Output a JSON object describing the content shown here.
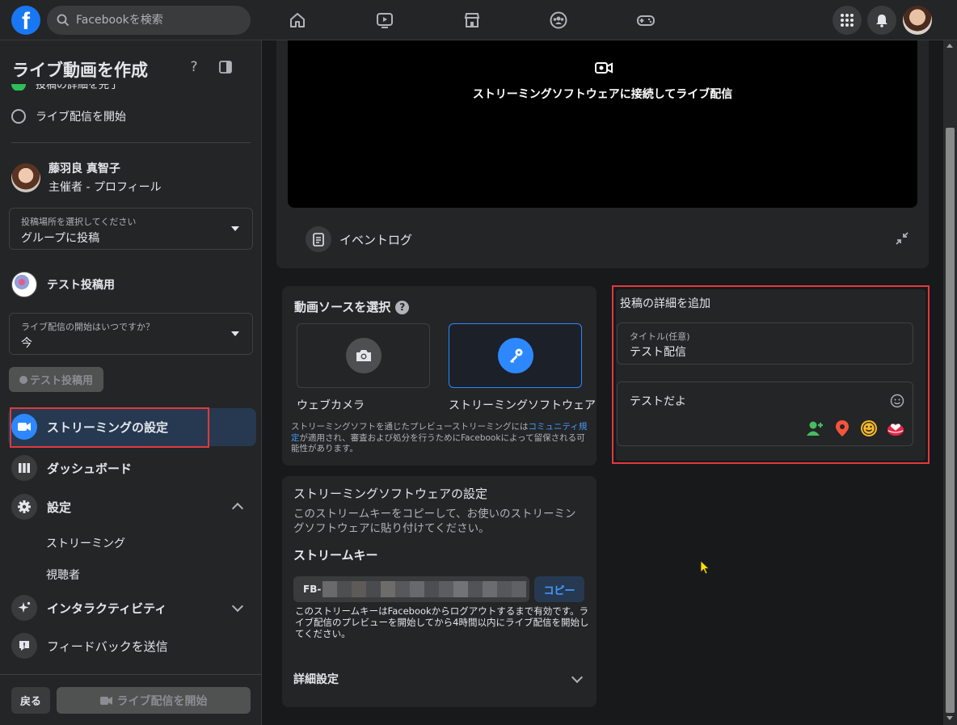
{
  "topbar": {
    "logo_letter": "f",
    "search_placeholder": "Facebookを検索"
  },
  "sidebar": {
    "title": "ライブ動画を作成",
    "step_cut": "投稿の詳細を完了",
    "step_next": "ライブ配信を開始",
    "host": {
      "name": "藤羽良 真智子",
      "role": "主催者 - プロフィール"
    },
    "post_location": {
      "label": "投稿場所を選択してください",
      "value": "グループに投稿"
    },
    "group_name": "テスト投稿用",
    "start_time": {
      "label": "ライブ配信の開始はいつですか？",
      "value": "今"
    },
    "group_button": "テスト投稿用",
    "menu": {
      "streaming_setup": "ストリーミングの設定",
      "dashboard": "ダッシュボード",
      "settings": "設定",
      "settings_sub": [
        "ストリーミング",
        "視聴者"
      ],
      "interactivity": "インタラクティビティ",
      "feedback": "フィードバックを送信"
    },
    "back_button": "戻る",
    "start_button": "ライブ配信を開始"
  },
  "preview": {
    "message": "ストリーミングソフトウェアに接続してライブ配信",
    "event_log": "イベントログ"
  },
  "video_source": {
    "title": "動画ソースを選択",
    "options": [
      "ウェブカメラ",
      "ストリーミングソフトウェア"
    ],
    "selected": "ストリーミングソフトウェア",
    "note_before": "ストリーミングソフトを通じたプレビューストリーミングには",
    "note_link": "コミュニティ規定",
    "note_after": "が適用され、審査および処分を行うためにFacebookによって留保される可能性があります。"
  },
  "software_settings": {
    "title": "ストリーミングソフトウェアの設定",
    "desc": "このストリームキーをコピーして、お使いのストリーミングソフトウェアに貼り付けてください。",
    "key_heading": "ストリームキー",
    "key_prefix": "FB-",
    "copy_button": "コピー",
    "key_note": "このストリームキーはFacebookからログアウトするまで有効です。ライブ配信のプレビューを開始してから4時間以内にライブ配信を開始してください。",
    "advanced": "詳細設定"
  },
  "post_details": {
    "title": "投稿の詳細を追加",
    "title_field_label": "タイトル(任意)",
    "title_field_value": "テスト配信",
    "description_value": "テストだよ"
  },
  "colors": {
    "accent": "#2d88ff",
    "highlight": "#e0393e",
    "active_bg": "#263951"
  }
}
